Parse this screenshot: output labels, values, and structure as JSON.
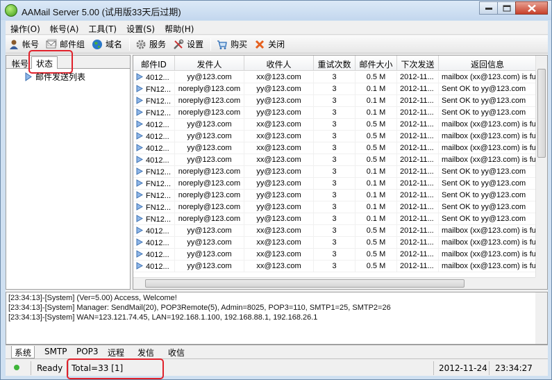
{
  "window": {
    "title": "AAMail Server 5.00 (试用版33天后过期)"
  },
  "menu": [
    "操作(O)",
    "帐号(A)",
    "工具(T)",
    "设置(S)",
    "帮助(H)"
  ],
  "toolbar": {
    "account": "帐号",
    "mailgroup": "邮件组",
    "domain": "域名",
    "service": "服务",
    "settings": "设置",
    "buy": "购买",
    "close": "关闭"
  },
  "left_tabs": {
    "tab1": "帐号",
    "tab2": "状态"
  },
  "tree": {
    "item": "邮件发送列表"
  },
  "grid": {
    "headers": [
      "邮件ID",
      "发件人",
      "收件人",
      "重试次数",
      "邮件大小",
      "下次发送",
      "返回信息"
    ],
    "rows": [
      [
        "4012...",
        "yy@123.com",
        "xx@123.com",
        "3",
        "0.5 M",
        "2012-11...",
        "mailbox (xx@123.com) is full"
      ],
      [
        "FN12...",
        "noreply@123.com",
        "yy@123.com",
        "3",
        "0.1 M",
        "2012-11...",
        "Sent OK to yy@123.com"
      ],
      [
        "FN12...",
        "noreply@123.com",
        "yy@123.com",
        "3",
        "0.1 M",
        "2012-11...",
        "Sent OK to yy@123.com"
      ],
      [
        "FN12...",
        "noreply@123.com",
        "yy@123.com",
        "3",
        "0.1 M",
        "2012-11...",
        "Sent OK to yy@123.com"
      ],
      [
        "4012...",
        "yy@123.com",
        "xx@123.com",
        "3",
        "0.5 M",
        "2012-11...",
        "mailbox (xx@123.com) is full"
      ],
      [
        "4012...",
        "yy@123.com",
        "xx@123.com",
        "3",
        "0.5 M",
        "2012-11...",
        "mailbox (xx@123.com) is full"
      ],
      [
        "4012...",
        "yy@123.com",
        "xx@123.com",
        "3",
        "0.5 M",
        "2012-11...",
        "mailbox (xx@123.com) is full"
      ],
      [
        "4012...",
        "yy@123.com",
        "xx@123.com",
        "3",
        "0.5 M",
        "2012-11...",
        "mailbox (xx@123.com) is full"
      ],
      [
        "FN12...",
        "noreply@123.com",
        "yy@123.com",
        "3",
        "0.1 M",
        "2012-11...",
        "Sent OK to yy@123.com"
      ],
      [
        "FN12...",
        "noreply@123.com",
        "yy@123.com",
        "3",
        "0.1 M",
        "2012-11...",
        "Sent OK to yy@123.com"
      ],
      [
        "FN12...",
        "noreply@123.com",
        "yy@123.com",
        "3",
        "0.1 M",
        "2012-11...",
        "Sent OK to yy@123.com"
      ],
      [
        "FN12...",
        "noreply@123.com",
        "yy@123.com",
        "3",
        "0.1 M",
        "2012-11...",
        "Sent OK to yy@123.com"
      ],
      [
        "FN12...",
        "noreply@123.com",
        "yy@123.com",
        "3",
        "0.1 M",
        "2012-11...",
        "Sent OK to yy@123.com"
      ],
      [
        "4012...",
        "yy@123.com",
        "xx@123.com",
        "3",
        "0.5 M",
        "2012-11...",
        "mailbox (xx@123.com) is full"
      ],
      [
        "4012...",
        "yy@123.com",
        "xx@123.com",
        "3",
        "0.5 M",
        "2012-11...",
        "mailbox (xx@123.com) is full"
      ],
      [
        "4012...",
        "yy@123.com",
        "xx@123.com",
        "3",
        "0.5 M",
        "2012-11...",
        "mailbox (xx@123.com) is full"
      ],
      [
        "4012...",
        "yy@123.com",
        "xx@123.com",
        "3",
        "0.5 M",
        "2012-11...",
        "mailbox (xx@123.com) is full"
      ]
    ]
  },
  "log": [
    "[23:34:13]-[System] (Ver=5.00) Access, Welcome!",
    "[23:34:13]-[System] Manager: SendMail(20), POP3Remote(5), Admin=8025, POP3=110, SMTP1=25, SMTP2=26",
    "[23:34:13]-[System] WAN=123.121.74.45, LAN=192.168.1.100, 192.168.88.1, 192.168.26.1"
  ],
  "bottom_tabs": [
    "系统",
    "SMTP",
    "POP3",
    "远程",
    "发信",
    "收信"
  ],
  "status": {
    "ready": "Ready",
    "total": "Total=33 [1]",
    "date": "2012-11-24",
    "time": "23:34:27"
  },
  "colors": {
    "highlight": "#e0202a",
    "title_bg": "#c3d7ee"
  }
}
